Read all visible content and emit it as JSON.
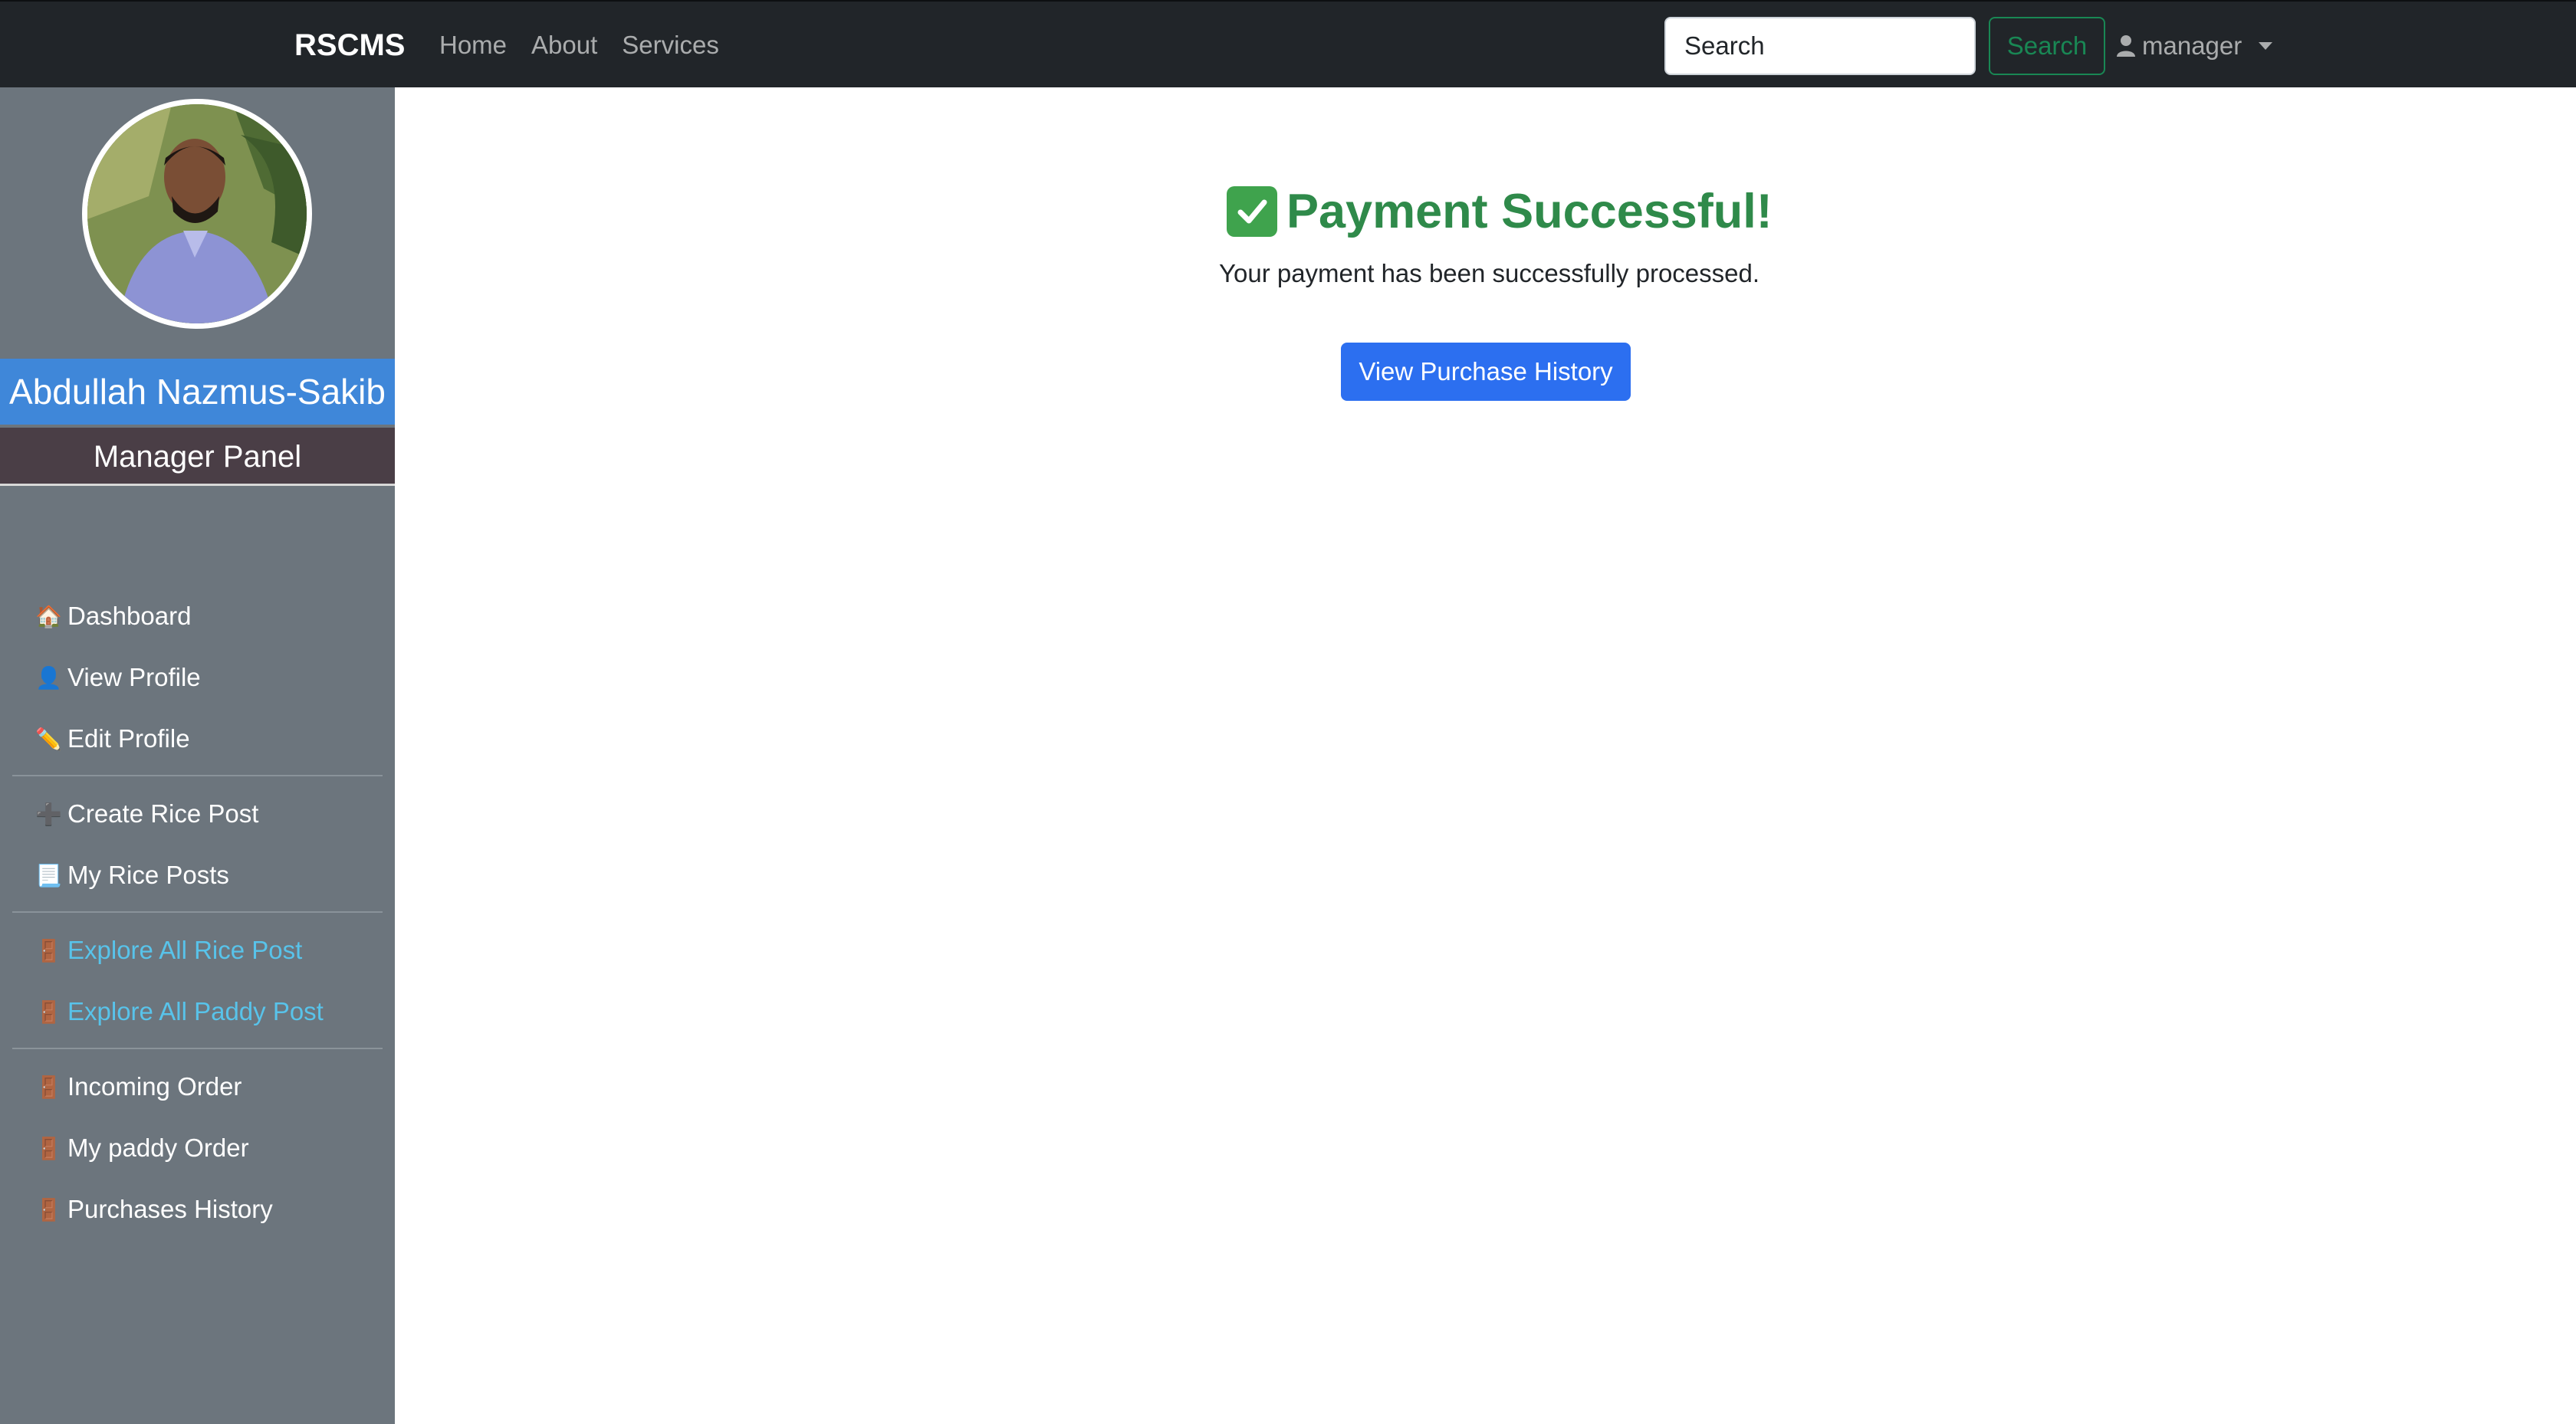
{
  "navbar": {
    "brand": "RSCMS",
    "links": [
      "Home",
      "About",
      "Services"
    ],
    "search_placeholder": "Search",
    "search_button": "Search",
    "user_label": "manager"
  },
  "sidebar": {
    "profile_name": "Abdullah Nazmus-Sakib",
    "panel_title": "Manager Panel",
    "groups": [
      [
        {
          "icon": "house-icon",
          "label": "Dashboard"
        },
        {
          "icon": "user-icon",
          "label": "View Profile"
        },
        {
          "icon": "pencil-icon",
          "label": "Edit Profile"
        }
      ],
      [
        {
          "icon": "plus-icon",
          "label": "Create Rice Post"
        },
        {
          "icon": "document-icon",
          "label": "My Rice Posts"
        }
      ],
      [
        {
          "icon": "door-icon",
          "label": "Explore All Rice Post"
        },
        {
          "icon": "door-icon",
          "label": "Explore All Paddy Post"
        }
      ],
      [
        {
          "icon": "door-icon",
          "label": "Incoming Order"
        },
        {
          "icon": "door-icon",
          "label": "My paddy Order"
        },
        {
          "icon": "door-icon",
          "label": "Purchases History"
        }
      ]
    ]
  },
  "main": {
    "title": "Payment Successful!",
    "message": "Your payment has been successfully processed.",
    "button": "View Purchase History"
  },
  "colors": {
    "navbar_bg": "#212529",
    "sidebar_bg": "#6c757d",
    "name_bar": "#3f87d9",
    "panel_bar": "#4a3e46",
    "success_green": "#2f8a4a",
    "link_blue": "#58c3ea",
    "primary_button": "#2c6ff0",
    "search_outline": "#198754"
  }
}
